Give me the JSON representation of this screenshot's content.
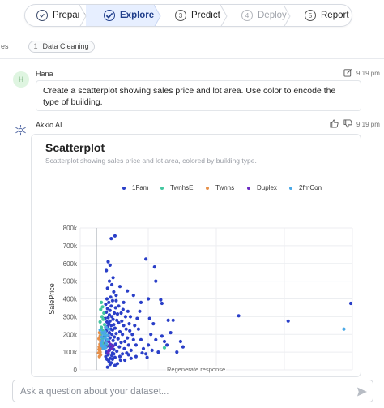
{
  "stepper": {
    "steps": [
      {
        "label": "Prepare",
        "num": "",
        "state": "done"
      },
      {
        "label": "Explore",
        "num": "",
        "state": "active"
      },
      {
        "label": "Predict",
        "num": "3",
        "state": "todo"
      },
      {
        "label": "Deploy",
        "num": "4",
        "state": "disabled"
      },
      {
        "label": "Report",
        "num": "5",
        "state": "todo"
      }
    ]
  },
  "breadcrumb": {
    "edge_text": "es",
    "chip_index": "1",
    "chip_label": "Data Cleaning"
  },
  "user_message": {
    "avatar_letter": "H",
    "author": "Hana",
    "time": "9:19 pm",
    "text": "Create a scatterplot showing sales price and lot area. Use color to encode the type of building."
  },
  "ai_message": {
    "author": "Akkio AI",
    "time": "9:19 pm"
  },
  "colors": {
    "1Fam": "#2a3fc8",
    "TwnhsE": "#43c7a0",
    "Twnhs": "#e7904a",
    "Duplex": "#6a2bc2",
    "2fmCon": "#4aa8e6"
  },
  "chart_data": {
    "type": "scatter",
    "title": "Scatterplot",
    "subtitle": "Scatterplot showing sales price and lot area, colored by building type.",
    "ylabel": "SalePrice",
    "xlabel": "",
    "ylim": [
      0,
      800000
    ],
    "y_ticks": [
      "0",
      "100k",
      "200k",
      "300k",
      "400k",
      "500k",
      "600k",
      "700k",
      "800k"
    ],
    "xlim": [
      0,
      220000
    ],
    "grid": true,
    "legend_position": "top",
    "series": [
      {
        "name": "1Fam",
        "points": [
          [
            12000,
            740000
          ],
          [
            15000,
            755000
          ],
          [
            9500,
            610000
          ],
          [
            11000,
            590000
          ],
          [
            8000,
            560000
          ],
          [
            13500,
            520000
          ],
          [
            10500,
            500000
          ],
          [
            12500,
            480000
          ],
          [
            9000,
            460000
          ],
          [
            14000,
            440000
          ],
          [
            16000,
            420000
          ],
          [
            11500,
            410000
          ],
          [
            8500,
            400000
          ],
          [
            13000,
            390000
          ],
          [
            10000,
            380000
          ],
          [
            7500,
            370000
          ],
          [
            12000,
            360000
          ],
          [
            15500,
            350000
          ],
          [
            9000,
            345000
          ],
          [
            11000,
            335000
          ],
          [
            8000,
            325000
          ],
          [
            14500,
            320000
          ],
          [
            17000,
            315000
          ],
          [
            10500,
            310000
          ],
          [
            12500,
            300000
          ],
          [
            9500,
            295000
          ],
          [
            7000,
            290000
          ],
          [
            13500,
            285000
          ],
          [
            16500,
            280000
          ],
          [
            11000,
            275000
          ],
          [
            8500,
            270000
          ],
          [
            18000,
            265000
          ],
          [
            10000,
            260000
          ],
          [
            14000,
            255000
          ],
          [
            12000,
            250000
          ],
          [
            9000,
            245000
          ],
          [
            7500,
            240000
          ],
          [
            15000,
            235000
          ],
          [
            11500,
            230000
          ],
          [
            13000,
            225000
          ],
          [
            8000,
            220000
          ],
          [
            19000,
            215000
          ],
          [
            10500,
            210000
          ],
          [
            16000,
            205000
          ],
          [
            12500,
            200000
          ],
          [
            9500,
            195000
          ],
          [
            6500,
            190000
          ],
          [
            14500,
            185000
          ],
          [
            11000,
            180000
          ],
          [
            17500,
            175000
          ],
          [
            8500,
            170000
          ],
          [
            13500,
            165000
          ],
          [
            10000,
            160000
          ],
          [
            20000,
            155000
          ],
          [
            7000,
            150000
          ],
          [
            15500,
            145000
          ],
          [
            12000,
            140000
          ],
          [
            9000,
            135000
          ],
          [
            18500,
            130000
          ],
          [
            11500,
            125000
          ],
          [
            6000,
            120000
          ],
          [
            14000,
            115000
          ],
          [
            10500,
            110000
          ],
          [
            16500,
            105000
          ],
          [
            8000,
            100000
          ],
          [
            13000,
            95000
          ],
          [
            21000,
            90000
          ],
          [
            9500,
            85000
          ],
          [
            12500,
            80000
          ],
          [
            7500,
            75000
          ],
          [
            15000,
            70000
          ],
          [
            11000,
            65000
          ],
          [
            8500,
            60000
          ],
          [
            19500,
            55000
          ],
          [
            10000,
            50000
          ],
          [
            22000,
            250000
          ],
          [
            24000,
            230000
          ],
          [
            21000,
            200000
          ],
          [
            25000,
            180000
          ],
          [
            23000,
            160000
          ],
          [
            26000,
            140000
          ],
          [
            22500,
            120000
          ],
          [
            28000,
            110000
          ],
          [
            24500,
            95000
          ],
          [
            20500,
            275000
          ],
          [
            23500,
            300000
          ],
          [
            27000,
            220000
          ],
          [
            30000,
            170000
          ],
          [
            26500,
            260000
          ],
          [
            29000,
            200000
          ],
          [
            32000,
            140000
          ],
          [
            27500,
            300000
          ],
          [
            21500,
            340000
          ],
          [
            25500,
            330000
          ],
          [
            31000,
            250000
          ],
          [
            18000,
            360000
          ],
          [
            16000,
            390000
          ],
          [
            20000,
            320000
          ],
          [
            22000,
            380000
          ],
          [
            34000,
            230000
          ],
          [
            36000,
            170000
          ],
          [
            38000,
            120000
          ],
          [
            40000,
            90000
          ],
          [
            33000,
            290000
          ],
          [
            35000,
            330000
          ],
          [
            42000,
            140000
          ],
          [
            45000,
            110000
          ],
          [
            50000,
            100000
          ],
          [
            44000,
            200000
          ],
          [
            48000,
            170000
          ],
          [
            55000,
            160000
          ],
          [
            53000,
            190000
          ],
          [
            57000,
            140000
          ],
          [
            46000,
            260000
          ],
          [
            58000,
            280000
          ],
          [
            25000,
            445000
          ],
          [
            30000,
            420000
          ],
          [
            19000,
            470000
          ],
          [
            36000,
            380000
          ],
          [
            43000,
            290000
          ],
          [
            40000,
            625000
          ],
          [
            47000,
            580000
          ],
          [
            48000,
            500000
          ],
          [
            42000,
            400000
          ],
          [
            52000,
            395000
          ],
          [
            53000,
            375000
          ],
          [
            62000,
            280000
          ],
          [
            68000,
            160000
          ],
          [
            70000,
            130000
          ],
          [
            65000,
            100000
          ],
          [
            60000,
            210000
          ],
          [
            115000,
            305000
          ],
          [
            155000,
            275000
          ],
          [
            215000,
            375000
          ],
          [
            14000,
            90000
          ],
          [
            13000,
            60000
          ],
          [
            11000,
            30000
          ],
          [
            9000,
            15000
          ],
          [
            17000,
            35000
          ],
          [
            15000,
            25000
          ],
          [
            12000,
            40000
          ],
          [
            19000,
            75000
          ],
          [
            23000,
            55000
          ],
          [
            28000,
            65000
          ],
          [
            26000,
            85000
          ],
          [
            32000,
            75000
          ],
          [
            37000,
            95000
          ],
          [
            41000,
            70000
          ]
        ]
      },
      {
        "name": "TwnhsE",
        "points": [
          [
            4000,
            380000
          ],
          [
            5000,
            355000
          ],
          [
            3500,
            340000
          ],
          [
            6000,
            320000
          ],
          [
            4500,
            300000
          ],
          [
            5500,
            285000
          ],
          [
            3000,
            270000
          ],
          [
            6500,
            255000
          ],
          [
            4000,
            240000
          ],
          [
            5000,
            225000
          ],
          [
            7000,
            210000
          ],
          [
            3500,
            195000
          ],
          [
            6000,
            180000
          ],
          [
            4500,
            170000
          ],
          [
            5500,
            150000
          ],
          [
            8000,
            140000
          ],
          [
            55000,
            125000
          ],
          [
            3800,
            130000
          ]
        ]
      },
      {
        "name": "Twnhs",
        "points": [
          [
            2500,
            210000
          ],
          [
            3000,
            190000
          ],
          [
            2000,
            175000
          ],
          [
            3500,
            160000
          ],
          [
            2800,
            145000
          ],
          [
            2200,
            130000
          ],
          [
            3200,
            120000
          ],
          [
            2600,
            110000
          ],
          [
            1800,
            95000
          ],
          [
            3400,
            85000
          ],
          [
            2400,
            75000
          ],
          [
            3000,
            100000
          ],
          [
            2000,
            115000
          ]
        ]
      },
      {
        "name": "Duplex",
        "points": [
          [
            9000,
            160000
          ],
          [
            11000,
            145000
          ],
          [
            8000,
            130000
          ],
          [
            12500,
            120000
          ],
          [
            10000,
            110000
          ],
          [
            13500,
            135000
          ],
          [
            7500,
            150000
          ],
          [
            9500,
            95000
          ]
        ]
      },
      {
        "name": "2fmCon",
        "points": [
          [
            6000,
            200000
          ],
          [
            7000,
            180000
          ],
          [
            5000,
            165000
          ],
          [
            8000,
            150000
          ],
          [
            6500,
            135000
          ],
          [
            5500,
            120000
          ],
          [
            9000,
            170000
          ],
          [
            7500,
            125000
          ],
          [
            4800,
            210000
          ],
          [
            6800,
            215000
          ],
          [
            8500,
            195000
          ],
          [
            10000,
            230000
          ],
          [
            7800,
            240000
          ],
          [
            4200,
            185000
          ],
          [
            3800,
            150000
          ],
          [
            4400,
            135000
          ],
          [
            200000,
            230000
          ],
          [
            3000,
            225000
          ]
        ]
      }
    ]
  },
  "regenerate_label": "Regenerate response",
  "composer": {
    "placeholder": "Ask a question about your dataset..."
  }
}
